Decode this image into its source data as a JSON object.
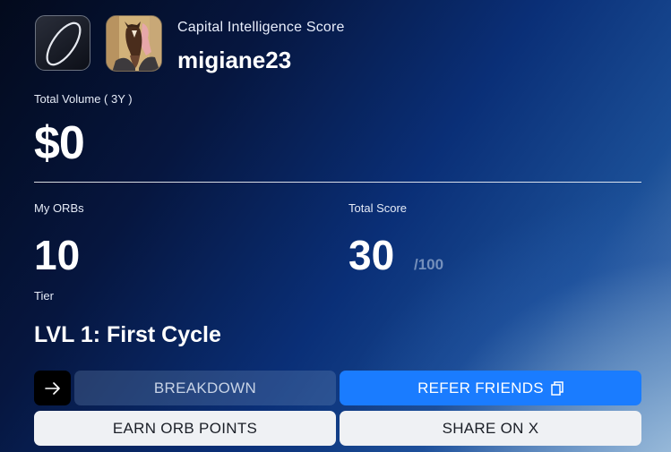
{
  "header": {
    "subtitle": "Capital Intelligence Score",
    "username": "migiane23"
  },
  "volume": {
    "label": "Total Volume ( 3Y )",
    "value": "$0"
  },
  "orbs": {
    "label": "My ORBs",
    "value": "10"
  },
  "score": {
    "label": "Total Score",
    "value": "30",
    "max": "/100"
  },
  "tier": {
    "label": "Tier",
    "value": "LVL 1: First Cycle"
  },
  "actions": {
    "arrow_icon": "arrow-right-icon",
    "breakdown_label": "BREAKDOWN",
    "refer_label": "REFER FRIENDS",
    "refer_icon": "copy-icon",
    "earn_label": "EARN ORB POINTS",
    "share_label": "SHARE ON X"
  },
  "colors": {
    "accent_blue": "#1a7cff",
    "light_button": "#eff1f4"
  }
}
